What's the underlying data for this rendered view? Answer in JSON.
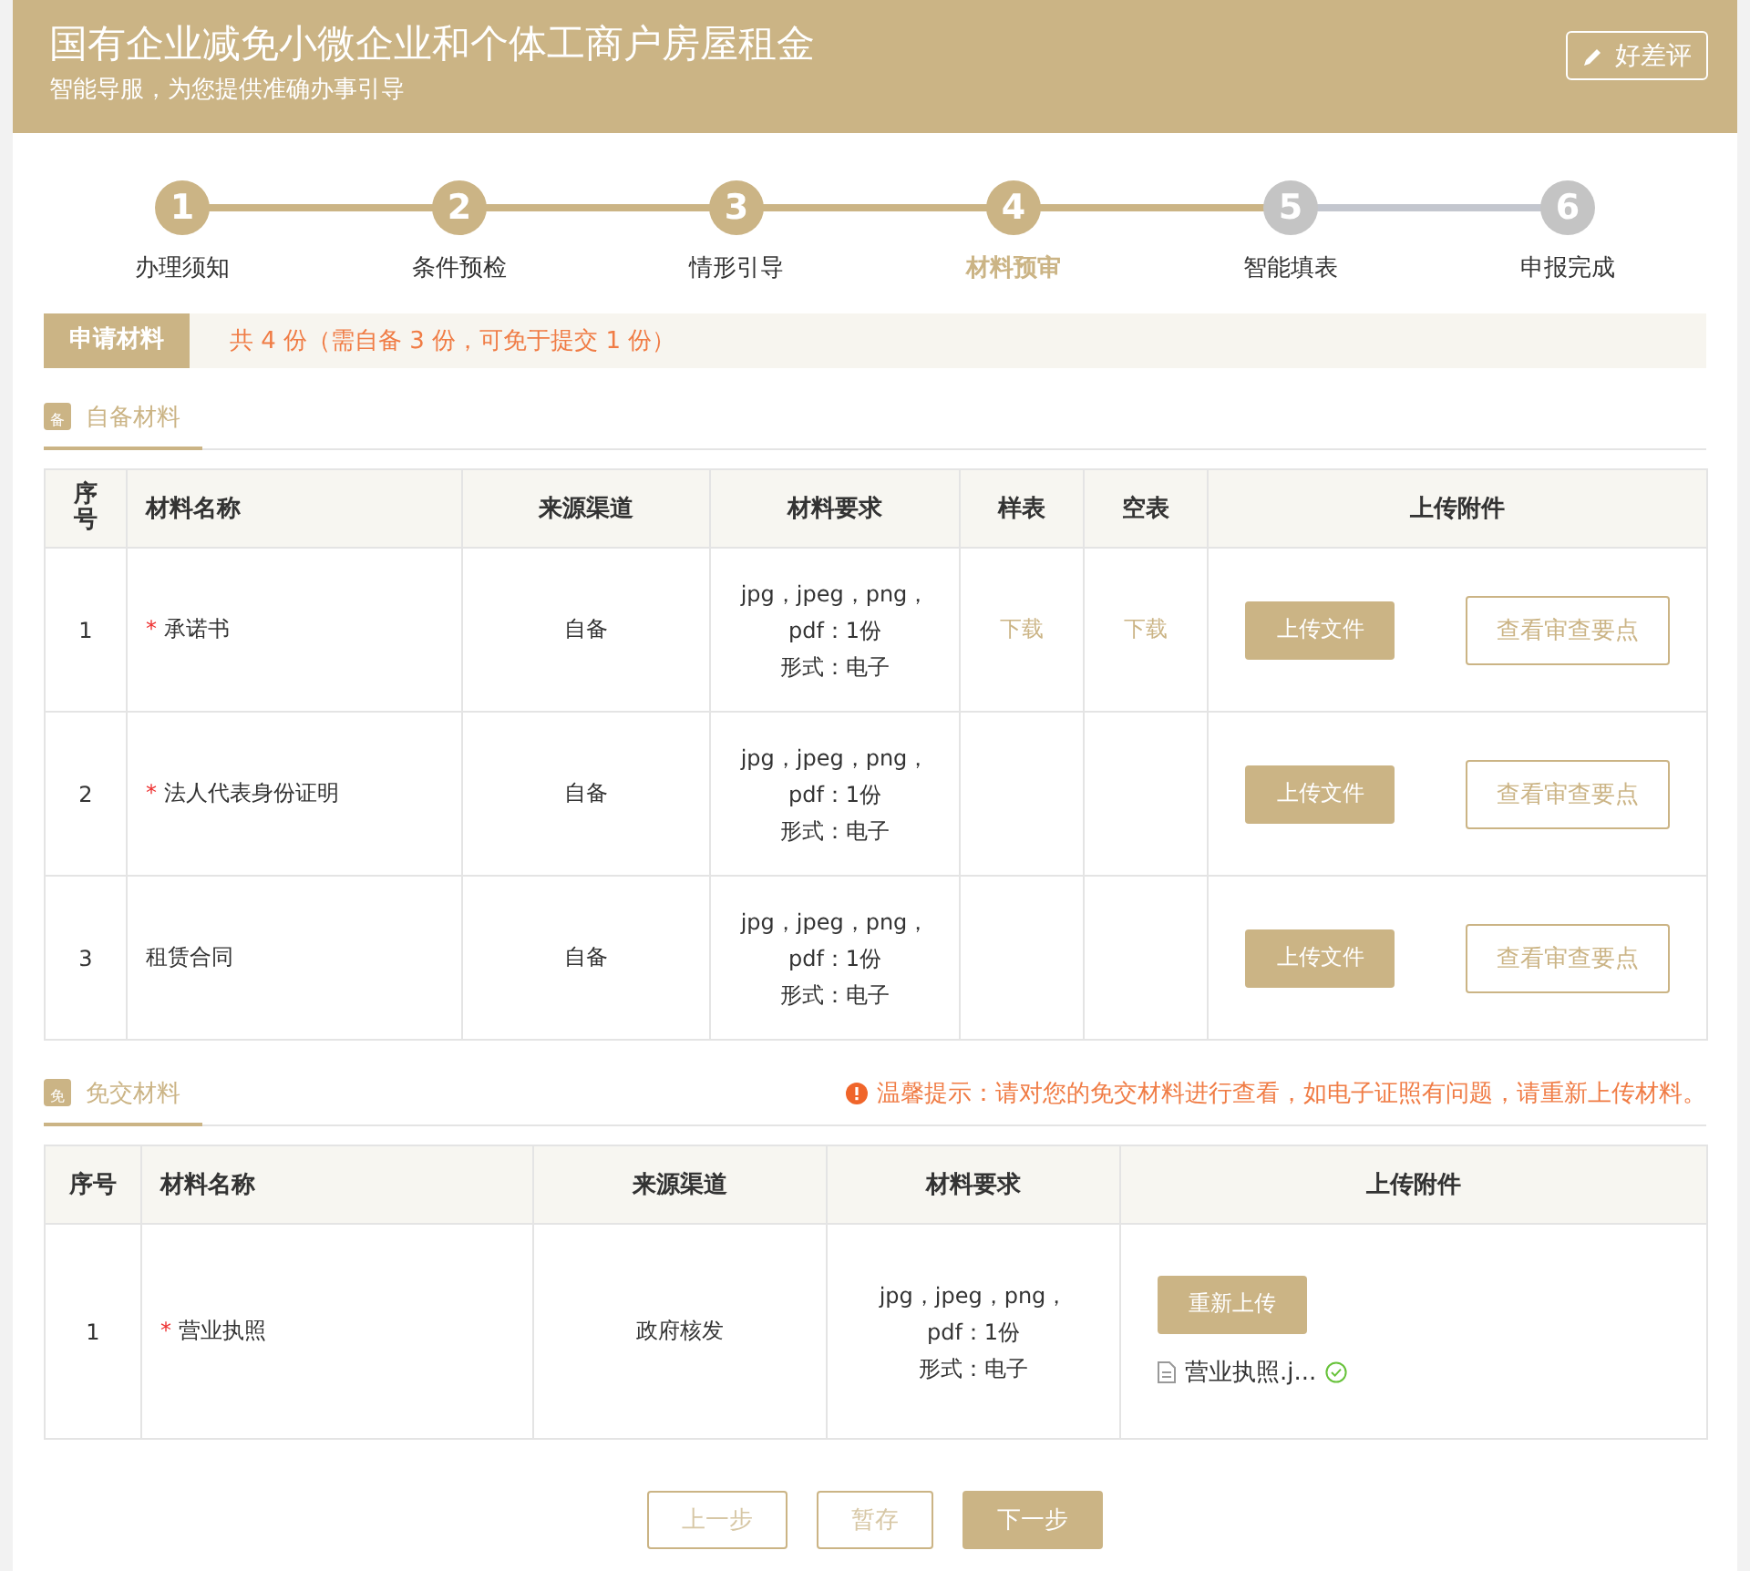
{
  "header": {
    "title": "国有企业减免小微企业和个体工商户房屋租金",
    "subtitle": "智能导服，为您提供准确办事引导",
    "rate_button": "好差评"
  },
  "steps": [
    {
      "number": "1",
      "label": "办理须知",
      "done": true,
      "current": false
    },
    {
      "number": "2",
      "label": "条件预检",
      "done": true,
      "current": false
    },
    {
      "number": "3",
      "label": "情形引导",
      "done": true,
      "current": false
    },
    {
      "number": "4",
      "label": "材料预审",
      "done": false,
      "current": true
    },
    {
      "number": "5",
      "label": "智能填表",
      "done": false,
      "current": false
    },
    {
      "number": "6",
      "label": "申报完成",
      "done": false,
      "current": false
    }
  ],
  "summary": {
    "tag": "申请材料",
    "text": "共 4 份（需自备 3 份，可免于提交 1 份）"
  },
  "self_section": {
    "title": "自备材料",
    "icon_char": "备",
    "columns": [
      "序号",
      "材料名称",
      "来源渠道",
      "材料要求",
      "样表",
      "空表",
      "上传附件"
    ],
    "rows": [
      {
        "index": "1",
        "required_mark": "*",
        "name": "承诺书",
        "source": "自备",
        "requirement": [
          "jpg，jpeg，png，",
          "pdf：1份",
          "形式：电子"
        ],
        "sample": "下载",
        "blank": "下载",
        "upload": "上传文件",
        "review": "查看审查要点"
      },
      {
        "index": "2",
        "required_mark": "*",
        "name": "法人代表身份证明",
        "source": "自备",
        "requirement": [
          "jpg，jpeg，png，",
          "pdf：1份",
          "形式：电子"
        ],
        "upload": "上传文件",
        "review": "查看审查要点"
      },
      {
        "index": "3",
        "name": "租赁合同",
        "source": "自备",
        "requirement": [
          "jpg，jpeg，png，",
          "pdf：1份",
          "形式：电子"
        ],
        "upload": "上传文件",
        "review": "查看审查要点"
      }
    ]
  },
  "exempt_section": {
    "title": "免交材料",
    "icon_char": "免",
    "notice": "温馨提示：请对您的免交材料进行查看，如电子证照有问题，请重新上传材料。",
    "columns": [
      "序号",
      "材料名称",
      "来源渠道",
      "材料要求",
      "上传附件"
    ],
    "rows": [
      {
        "index": "1",
        "required_mark": "*",
        "name": "营业执照",
        "source": "政府核发",
        "requirement": [
          "jpg，jpeg，png，",
          "pdf：1份",
          "形式：电子"
        ],
        "reupload": "重新上传",
        "file_name": "营业执照.j...",
        "verified": true
      }
    ]
  },
  "footer_buttons": [
    {
      "label": "上一步",
      "kind": "outline"
    },
    {
      "label": "暂存",
      "kind": "outline"
    },
    {
      "label": "下一步",
      "kind": "primary"
    }
  ]
}
